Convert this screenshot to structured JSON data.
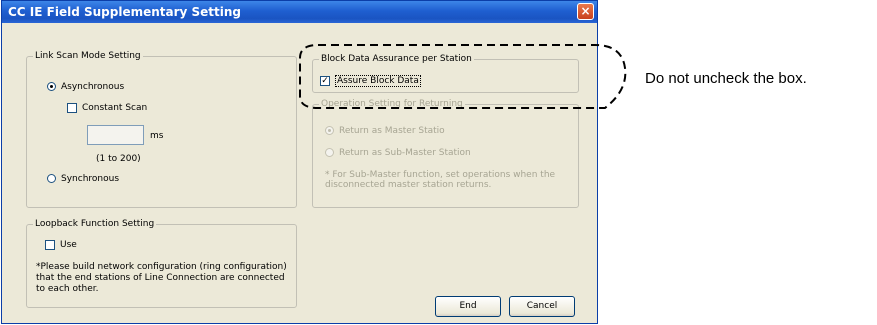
{
  "window": {
    "title": "CC IE Field Supplementary Setting",
    "close_symbol": "×"
  },
  "link_scan": {
    "group_label": "Link Scan Mode Setting",
    "asynchronous_label": "Asynchronous",
    "asynchronous_selected": true,
    "constant_scan_label": "Constant Scan",
    "constant_scan_checked": false,
    "ms_value": "",
    "ms_unit": "ms",
    "range_hint": "(1 to 200)",
    "synchronous_label": "Synchronous",
    "synchronous_selected": false
  },
  "loopback": {
    "group_label": "Loopback Function Setting",
    "use_label": "Use",
    "use_checked": false,
    "note_text_1": "*Please build network configuration (ring configuration)",
    "note_text_2": "that the end stations of Line Connection are connected",
    "note_text_3": "to each other."
  },
  "block_data": {
    "group_label": "Block Data Assurance per Station",
    "assure_label": "Assure Block Data",
    "assure_checked": true,
    "check_mark": "✓"
  },
  "operation_returning": {
    "group_label": "Operation Setting for Returning",
    "master_label": "Return as Master Statio",
    "master_selected": true,
    "sub_master_label": "Return as Sub-Master Station",
    "sub_master_selected": false,
    "note_1": "* For Sub-Master function, set operations when the",
    "note_2": "disconnected master station returns."
  },
  "buttons": {
    "end_label": "End",
    "cancel_label": "Cancel"
  },
  "annotation": {
    "text": "Do not uncheck the box."
  }
}
